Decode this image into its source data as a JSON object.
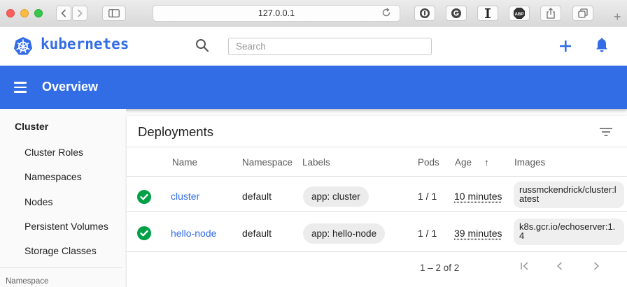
{
  "browser": {
    "url": "127.0.0.1"
  },
  "header": {
    "brand": "kubernetes",
    "search_placeholder": "Search"
  },
  "toolbar": {
    "title": "Overview"
  },
  "sidebar": {
    "section": "Cluster",
    "items": [
      {
        "label": "Cluster Roles"
      },
      {
        "label": "Namespaces"
      },
      {
        "label": "Nodes"
      },
      {
        "label": "Persistent Volumes"
      },
      {
        "label": "Storage Classes"
      }
    ],
    "namespace_label": "Namespace"
  },
  "deployments": {
    "title": "Deployments",
    "columns": {
      "name": "Name",
      "namespace": "Namespace",
      "labels": "Labels",
      "pods": "Pods",
      "age": "Age",
      "age_sort": "↑",
      "images": "Images"
    },
    "rows": [
      {
        "status": "running",
        "name": "cluster",
        "namespace": "default",
        "label": "app: cluster",
        "pods": "1 / 1",
        "age": "10 minutes",
        "image": "russmckendrick/cluster:latest"
      },
      {
        "status": "running",
        "name": "hello-node",
        "namespace": "default",
        "label": "app: hello-node",
        "pods": "1 / 1",
        "age": "39 minutes",
        "image": "k8s.gcr.io/echoserver:1.4"
      }
    ],
    "pagination": {
      "range": "1 – 2 of 2"
    }
  },
  "colors": {
    "brand": "#326de6",
    "status_ok": "#00a046"
  }
}
